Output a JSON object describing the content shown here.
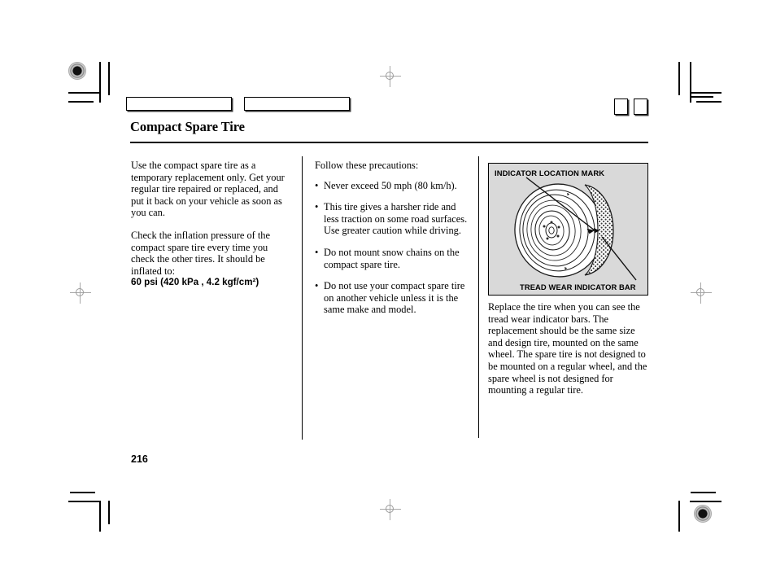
{
  "document": {
    "title": "Compact Spare Tire",
    "page_number": "216"
  },
  "columns": {
    "left": {
      "paragraphs": [
        "Use the compact spare tire as a temporary replacement only. Get your regular tire repaired or replaced, and put it back on your vehicle as soon as you can.",
        "Check the inflation pressure of the compact spare tire every time you check the other tires. It should be inflated to:"
      ],
      "spec": "60 psi (420 kPa , 4.2 kgf/cm²)"
    },
    "middle": {
      "intro": "Follow these precautions:",
      "bullets": [
        "Never exceed 50 mph (80 km/h).",
        "This tire gives a harsher ride and less traction on some road surfaces. Use greater caution while driving.",
        "Do not mount snow chains on the compact spare tire.",
        "Do not use your compact spare tire on another vehicle unless it is the same make and model."
      ],
      "bullet_glyph": "•"
    },
    "right": {
      "figure": {
        "label_top": "INDICATOR LOCATION MARK",
        "label_bottom": "TREAD WEAR INDICATOR BAR",
        "background_color": "#d9d9d9",
        "subject": "compact-spare-tire-illustration"
      },
      "paragraph": "Replace the tire when you can see the tread wear indicator bars. The replacement should be the same size and design tire, mounted on the same wheel. The spare tire is not designed to be mounted on a regular wheel, and the spare wheel is not designed for mounting a regular tire."
    }
  },
  "print_marks": {
    "tab_boxes": [
      "",
      ""
    ],
    "mini_boxes": [
      "",
      ""
    ],
    "registration": "registration-target"
  }
}
